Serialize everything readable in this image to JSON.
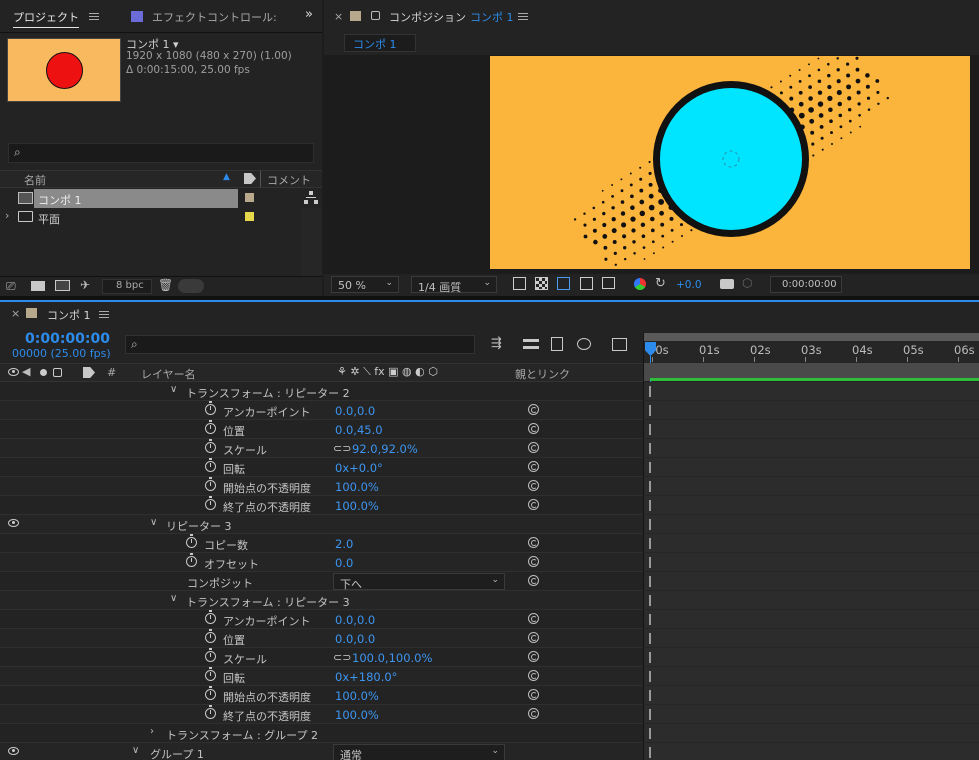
{
  "project_panel": {
    "tab_label": "プロジェクト",
    "effects_tab_label": "エフェクトコントロール: ",
    "comp_name": "コンポ 1 ▾",
    "comp_size": "1920 x 1080  (480 x 270) (1.00)",
    "comp_duration": "Δ 0:00:15:00, 25.00 fps",
    "search_placeholder": "",
    "col_name": "名前",
    "col_comment": "コメント",
    "items": [
      {
        "name": "コンポ 1",
        "type": "composition",
        "label_color": "#b9a98c"
      },
      {
        "name": "平面",
        "type": "folder",
        "label_color": "#e6d84a"
      }
    ],
    "bpc": "8 bpc"
  },
  "comp_panel": {
    "title": "コンポジション",
    "title_comp": "コンポ 1",
    "tab": "コンポ 1",
    "zoom": "50 %",
    "quality": "1/4 画質",
    "exposure": "+0.0",
    "timecode": "0:00:00:00",
    "canvas": {
      "background": "#fbb43c",
      "circle": "#00e5ff",
      "dots": "#111111"
    }
  },
  "timeline": {
    "tab": "コンポ 1",
    "timecode": "0:00:00:00",
    "frames": "00000 (25.00 fps)",
    "search_placeholder": "",
    "col_hash": "#",
    "col_layer_name": "レイヤー名",
    "col_parent": "親とリンク",
    "ruler": [
      "00s",
      "01s",
      "02s",
      "03s",
      "04s",
      "05s",
      "06s"
    ],
    "rows": [
      {
        "kind": "group",
        "label": "トランスフォーム : リピーター 2",
        "chev": "∨"
      },
      {
        "kind": "prop",
        "label": "アンカーポイント",
        "value": "0.0,0.0"
      },
      {
        "kind": "prop",
        "label": "位置",
        "value": "0.0,45.0"
      },
      {
        "kind": "prop",
        "label": "スケール",
        "value": "92.0,92.0%",
        "link": true
      },
      {
        "kind": "prop",
        "label": "回転",
        "value": "0x+0.0°"
      },
      {
        "kind": "prop",
        "label": "開始点の不透明度",
        "value": "100.0%"
      },
      {
        "kind": "prop",
        "label": "終了点の不透明度",
        "value": "100.0%"
      },
      {
        "kind": "group",
        "label": "リピーター 3",
        "chev": "∨",
        "eye": true
      },
      {
        "kind": "prop2",
        "label": "コピー数",
        "value": "2.0"
      },
      {
        "kind": "prop2",
        "label": "オフセット",
        "value": "0.0"
      },
      {
        "kind": "dropdown",
        "label": "コンポジット",
        "value": "下へ"
      },
      {
        "kind": "group",
        "label": "トランスフォーム : リピーター 3",
        "chev": "∨"
      },
      {
        "kind": "prop",
        "label": "アンカーポイント",
        "value": "0.0,0.0"
      },
      {
        "kind": "prop",
        "label": "位置",
        "value": "0.0,0.0"
      },
      {
        "kind": "prop",
        "label": "スケール",
        "value": "100.0,100.0%",
        "link": true
      },
      {
        "kind": "prop",
        "label": "回転",
        "value": "0x+180.0°"
      },
      {
        "kind": "prop",
        "label": "開始点の不透明度",
        "value": "100.0%"
      },
      {
        "kind": "prop",
        "label": "終了点の不透明度",
        "value": "100.0%"
      },
      {
        "kind": "group2",
        "label": "トランスフォーム : グループ 2",
        "chev": "›"
      },
      {
        "kind": "group3",
        "label": "グループ 1",
        "chev": "∨",
        "eye": true,
        "dropdown": "通常"
      }
    ]
  }
}
